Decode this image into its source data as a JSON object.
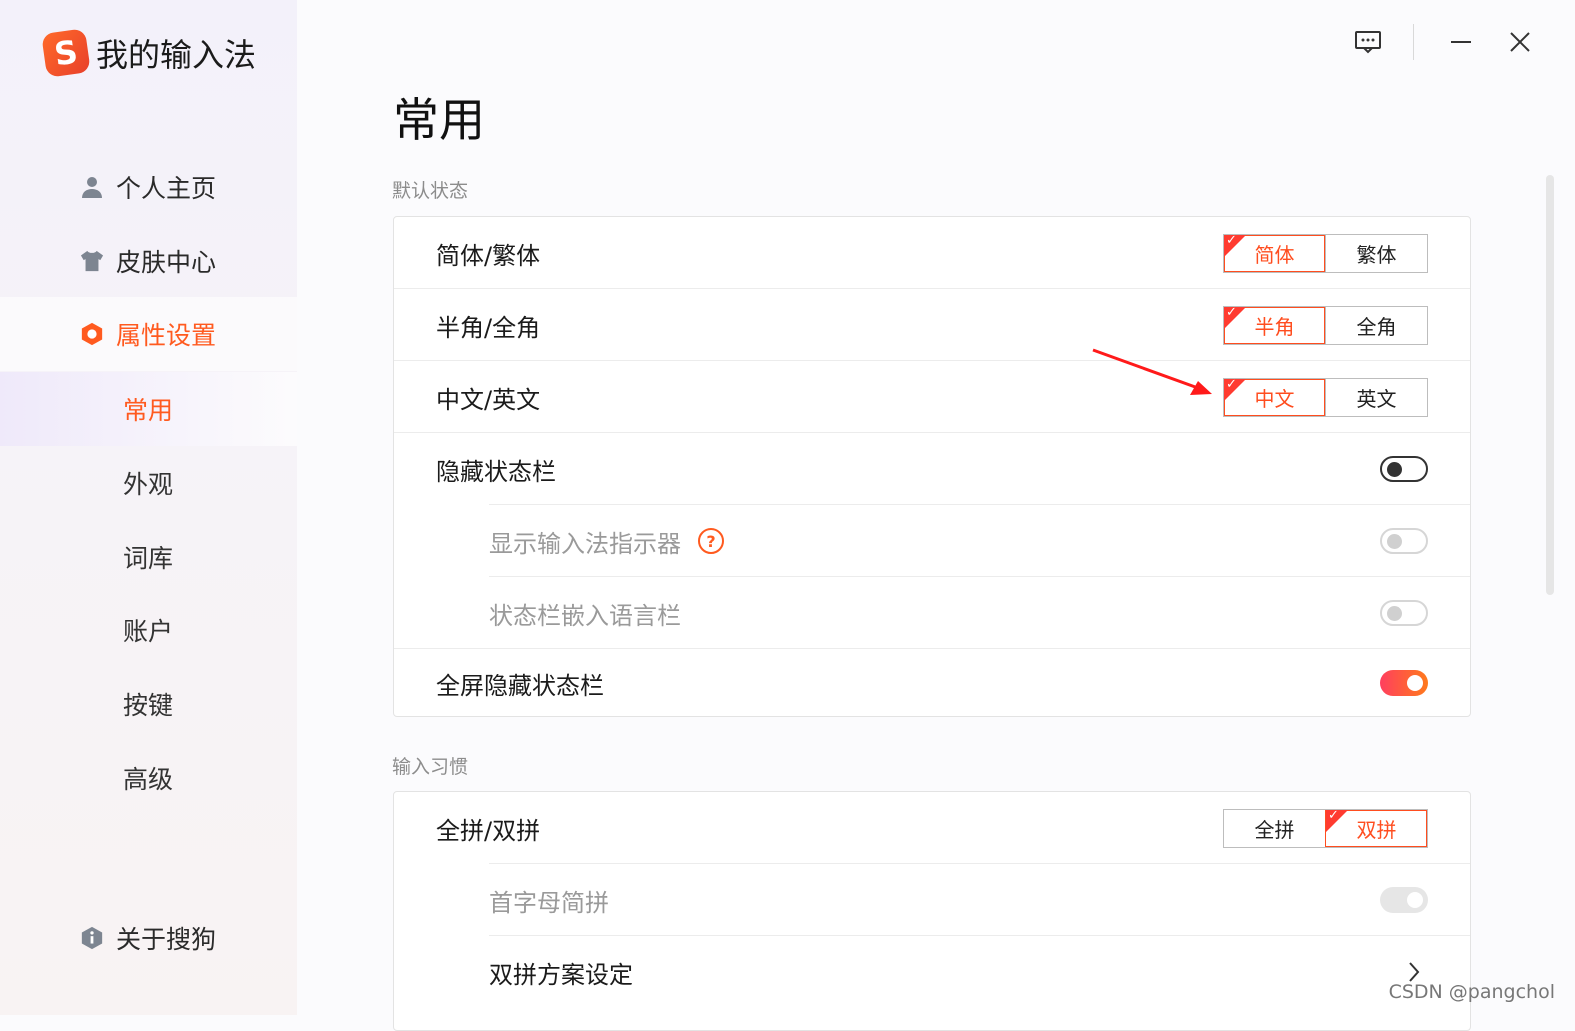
{
  "app": {
    "title": "我的输入法",
    "logo_letter": "S"
  },
  "sidebar": {
    "items": [
      {
        "label": "个人主页",
        "icon": "user-icon"
      },
      {
        "label": "皮肤中心",
        "icon": "shirt-icon"
      },
      {
        "label": "属性设置",
        "icon": "hexagon-settings-icon",
        "active": true
      },
      {
        "label": "关于搜狗",
        "icon": "info-hexagon-icon"
      }
    ],
    "sub_items": [
      {
        "label": "常用",
        "active": true
      },
      {
        "label": "外观"
      },
      {
        "label": "词库"
      },
      {
        "label": "账户"
      },
      {
        "label": "按键"
      },
      {
        "label": "高级"
      }
    ]
  },
  "window": {
    "icons": [
      "feedback-icon",
      "minimize-icon",
      "close-icon"
    ]
  },
  "main": {
    "title": "常用",
    "sections": [
      {
        "label": "默认状态",
        "rows": [
          {
            "label": "简体/繁体",
            "type": "segment",
            "options": [
              "简体",
              "繁体"
            ],
            "selected": 0
          },
          {
            "label": "半角/全角",
            "type": "segment",
            "options": [
              "半角",
              "全角"
            ],
            "selected": 0
          },
          {
            "label": "中文/英文",
            "type": "segment",
            "options": [
              "中文",
              "英文"
            ],
            "selected": 0
          },
          {
            "label": "隐藏状态栏",
            "type": "toggle",
            "value": false
          },
          {
            "label": "显示输入法指示器",
            "type": "toggle",
            "value": false,
            "disabled": true,
            "sub": true,
            "help": "?"
          },
          {
            "label": "状态栏嵌入语言栏",
            "type": "toggle",
            "value": false,
            "disabled": true,
            "sub": true
          },
          {
            "label": "全屏隐藏状态栏",
            "type": "toggle",
            "value": true
          }
        ]
      },
      {
        "label": "输入习惯",
        "rows": [
          {
            "label": "全拼/双拼",
            "type": "segment",
            "options": [
              "全拼",
              "双拼"
            ],
            "selected": 1
          },
          {
            "label": "首字母简拼",
            "type": "toggle",
            "value": true,
            "disabled": true,
            "sub": true
          },
          {
            "label": "双拼方案设定",
            "type": "link",
            "sub": true
          }
        ]
      }
    ]
  },
  "colors": {
    "accent": "#ff5a1f",
    "selected_red": "#ff3b30",
    "toggle_on_start": "#ff3f5e",
    "toggle_on_end": "#ff7a1c"
  },
  "watermark": "CSDN @pangchol"
}
